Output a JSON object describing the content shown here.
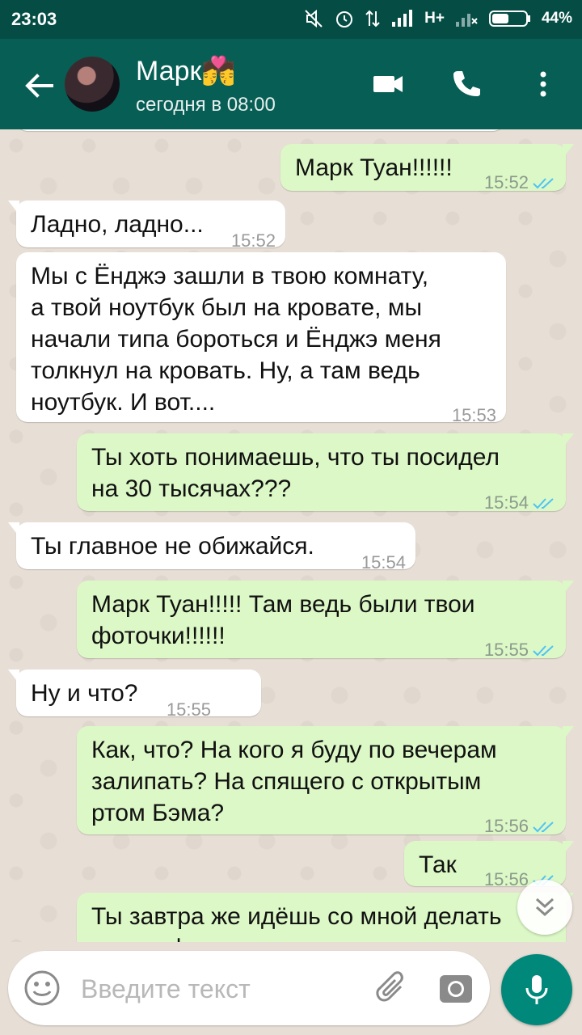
{
  "status_bar": {
    "time": "23:03",
    "network": "H+",
    "battery": "44%"
  },
  "header": {
    "contact_name": "Марк💏",
    "last_seen": "сегодня в 08:00"
  },
  "messages": [
    {
      "text": "Марк Туан!!!!!!",
      "time": "15:52"
    },
    {
      "text": "Ладно, ладно...",
      "time": "15:52"
    },
    {
      "text": "Мы с Ёнджэ зашли в твою комнату,\nа твой ноутбук был на кровате, мы\nначали типа бороться и Ёнджэ меня\nтолкнул на кровать. Ну, а там ведь\nноутбук. И вот....",
      "time": "15:53"
    },
    {
      "text": "Ты хоть понимаешь, что ты посидел\nна 30 тысячах???",
      "time": "15:54"
    },
    {
      "text": "Ты главное не обижайся.",
      "time": "15:54"
    },
    {
      "text": "Марк Туан!!!!! Там ведь были твои\nфоточки!!!!!!",
      "time": "15:55"
    },
    {
      "text": "Ну и что?",
      "time": "15:55"
    },
    {
      "text": " Как, что? На кого я буду по вечерам\nзалипать? На спящего с открытым\nртом Бэма?",
      "time": "15:56"
    },
    {
      "text": "Так",
      "time": "15:56"
    },
    {
      "text": "Ты завтра же идёшь со мной делать\nновые фото",
      "time": ""
    }
  ],
  "composer": {
    "placeholder": "Введите текст"
  },
  "colors": {
    "header": "#075e54",
    "statusbar": "#054d44",
    "outgoing_bubble": "#dcf8c6",
    "incoming_bubble": "#ffffff",
    "read_ticks": "#4fc3f7",
    "mic_button": "#00897b"
  },
  "icons": [
    "back-arrow-icon",
    "video-call-icon",
    "phone-icon",
    "more-vert-icon",
    "emoji-icon",
    "attach-icon",
    "camera-icon",
    "mic-icon",
    "scroll-down-icon"
  ]
}
